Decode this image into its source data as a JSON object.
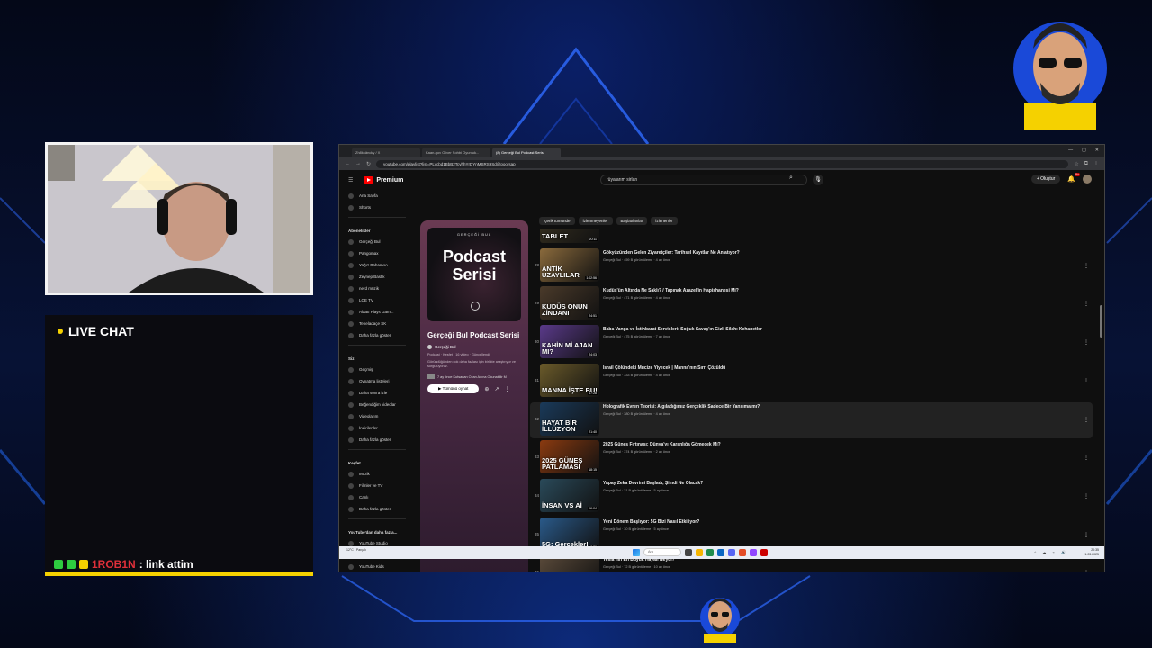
{
  "browser": {
    "tabs": [
      {
        "label": "Zh8kkäncky / X"
      },
      {
        "label": "Kaan-gov Oliver Sohbi Oyuntuk..."
      },
      {
        "label": "(8) Gerçeği Bul Podcast Serisi"
      }
    ],
    "url": "youtube.com/playlist?list=PLycbd1BbB2TcyhhYrDYnMSRS9Sd@poorsap"
  },
  "youtube": {
    "logo_label": "Premium",
    "search_value": "rüyalarım sirları",
    "create_label": "Oluştur",
    "notif_count": "9+",
    "sidebar": {
      "top": [
        {
          "label": "Ana Sayfa",
          "icon": "home-icon"
        },
        {
          "label": "Shorts",
          "icon": "shorts-icon"
        }
      ],
      "subscriptions_header": "Abonelikler",
      "subscriptions": [
        {
          "label": "Gerçeği Bul"
        },
        {
          "label": "Pangomax"
        },
        {
          "label": "Yağız Babamoo..."
        },
        {
          "label": "Zeynep Bastik"
        },
        {
          "label": "nerd müzik"
        },
        {
          "label": "LOE TV"
        },
        {
          "label": "Alaatı Plays Gam..."
        },
        {
          "label": "Teneladaçe SK"
        },
        {
          "label": "Daha fazla göster"
        }
      ],
      "you_header": "Siz",
      "you": [
        {
          "label": "Geçmiş"
        },
        {
          "label": "Oynatma listeleri"
        },
        {
          "label": "Daha sonra izle"
        },
        {
          "label": "Beğendiğim videolar"
        },
        {
          "label": "Videolarım"
        },
        {
          "label": "İndirilenler"
        },
        {
          "label": "Daha fazla göster"
        }
      ],
      "explore_header": "Keşfet",
      "explore": [
        {
          "label": "Müzik"
        },
        {
          "label": "Filmler ve TV"
        },
        {
          "label": "Canlı"
        },
        {
          "label": "Daha fazla göster"
        }
      ],
      "more_header": "YouTube'dan daha fazla...",
      "more": [
        {
          "label": "YouTube Studio"
        },
        {
          "label": "YouTube Music"
        },
        {
          "label": "YouTube Kids"
        }
      ]
    },
    "playlist": {
      "thumb_top": "GERÇEĞİ BUL",
      "thumb_title": "Podcast Serisi",
      "title": "Gerçeği Bul Podcast Serisi",
      "owner": "Gerçeği Bul",
      "meta": "Podcast · Keşfet · 16 video · Güncellendi",
      "description": "Göründüğünden çok daha fazlası için birlikte araştırıyor ve sorguluyoruz.",
      "last_added": "7 ay önce Kutsanan Ozan Adına Okunabilir M",
      "play_label": "Tümünü oynat"
    },
    "chips": [
      "İçerik tümünde",
      "İzlenmeyenler",
      "Başlatılanlar",
      "İzlenenler"
    ],
    "videos": [
      {
        "idx": "",
        "thumb": "TABLET",
        "dur": "20:11",
        "title": "",
        "meta": "",
        "color": "#3a3322",
        "hover": false
      },
      {
        "idx": "28",
        "thumb": "ANTİK UZAYLILAR",
        "dur": "1:02:56",
        "title": "Gökyüzünden Gelen Ziyaretçiler: Tarihsel Kayıtlar Ne Anlatıyor?",
        "meta": "Gerçeği Bul · 459 B görüntüleme · 4 ay önce",
        "color": "#8a6a3c",
        "hover": false
      },
      {
        "idx": "29",
        "thumb": "KUDÜS ONUN ZİNDANI",
        "dur": "24:51",
        "title": "Kudüs'ün Altında Ne Saklı? / Tapınak Azazel'in Hapishanesi Mi?",
        "meta": "Gerçeği Bul · 471 B görüntüleme · 4 ay önce",
        "color": "#4a3a2a",
        "hover": false
      },
      {
        "idx": "30",
        "thumb": "KAHİN Mİ AJAN MI?",
        "dur": "24:03",
        "title": "Baba Vanga ve İstihbarat Servisleri: Soğuk Savaş'ın Gizli Silahı Kehanetler",
        "meta": "Gerçeği Bul · 475 B görüntüleme · 7 ay önce",
        "color": "#5a3a8a",
        "hover": false
      },
      {
        "idx": "31",
        "thumb": "MANNA İŞTE BU!",
        "dur": "17:28",
        "title": "İsrail Çölündeki Mucize Yiyecek | Manna'nın Sırrı Çözüldü",
        "meta": "Gerçeği Bul · 333 B görüntüleme · 4 ay önce",
        "color": "#6a5a2a",
        "hover": false
      },
      {
        "idx": "32",
        "thumb": "HAYAT BİR İLLÜZYON",
        "dur": "21:40",
        "title": "Holografik Evren Teorisi: Algıladığımız Gerçeklik Sadece Bir Yansıma mı?",
        "meta": "Gerçeği Bul · 380 B görüntüleme · 4 ay önce",
        "color": "#1a3a5a",
        "hover": true
      },
      {
        "idx": "33",
        "thumb": "2025 GÜNEŞ PATLAMASI",
        "dur": "18:15",
        "title": "2025 Güneş Fırtınası: Dünya'yı Karanlığa Gömecek Mi?",
        "meta": "Gerçeği Bul · 374 B görüntüleme · 2 ay önce",
        "color": "#8a3a10",
        "hover": false
      },
      {
        "idx": "34",
        "thumb": "İNSAN VS Aİ",
        "dur": "16:04",
        "title": "Yapay Zeka Devrimi Başladı, Şimdi Ne Olacak?",
        "meta": "Gerçeği Bul · 21 B görüntüleme · 5 ay önce",
        "color": "#2a4a5a",
        "hover": false
      },
      {
        "idx": "35",
        "thumb": "5G: Gerçekler!",
        "dur": "9:36",
        "title": "Yeni Dönem Başlıyor: 5G Bizi Nasıl Etkiliyor?",
        "meta": "Gerçeği Bul · 30 B görüntüleme · 5 ay önce",
        "color": "#2a5a8a",
        "hover": false
      },
      {
        "idx": "36",
        "thumb": "SONSUZ ENERJİ",
        "dur": "12:09",
        "title": "Tesla'nın En Büyük Hayali Neydi?",
        "meta": "Gerçeği Bul · 72 B görüntüleme · 10 ay önce",
        "color": "#5a4a3a",
        "hover": false
      }
    ]
  },
  "taskbar": {
    "weather": "12°C · Parçalı",
    "search_label": "Ara",
    "time": "20:35",
    "date": "1.03.2025"
  },
  "chat": {
    "title": "LIVE CHAT",
    "message_user": "1ROB1N",
    "message_text": ": link attim"
  },
  "colors": {
    "accent_yellow": "#f5d100",
    "youtube_red": "#ff0000",
    "chat_user": "#e0303a"
  }
}
